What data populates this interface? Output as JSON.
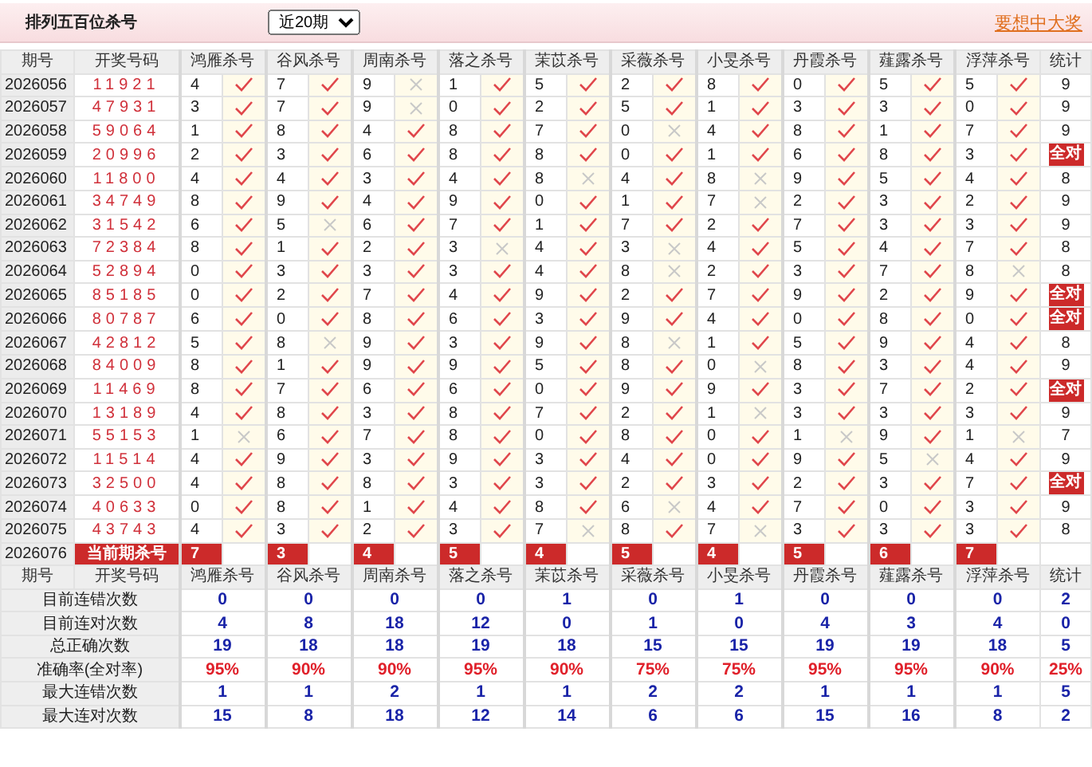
{
  "header": {
    "title": "排列五百位杀号",
    "period_select": "近20期",
    "promo_link": "要想中大奖"
  },
  "columns": [
    "期号",
    "开奖号码",
    "鸿雁杀号",
    "谷风杀号",
    "周南杀号",
    "落之杀号",
    "茉苡杀号",
    "采薇杀号",
    "小旻杀号",
    "丹霞杀号",
    "薤露杀号",
    "浮萍杀号",
    "统计"
  ],
  "rows": [
    {
      "period": "2026056",
      "numbers": "11921",
      "picks": [
        {
          "num": "4",
          "hit": true
        },
        {
          "num": "7",
          "hit": true
        },
        {
          "num": "9",
          "hit": false
        },
        {
          "num": "1",
          "hit": true
        },
        {
          "num": "5",
          "hit": true
        },
        {
          "num": "2",
          "hit": true
        },
        {
          "num": "8",
          "hit": true
        },
        {
          "num": "0",
          "hit": true
        },
        {
          "num": "5",
          "hit": true
        },
        {
          "num": "5",
          "hit": true
        }
      ],
      "total": {
        "text": "9",
        "kind": "count"
      }
    },
    {
      "period": "2026057",
      "numbers": "47931",
      "picks": [
        {
          "num": "3",
          "hit": true
        },
        {
          "num": "7",
          "hit": true
        },
        {
          "num": "9",
          "hit": false
        },
        {
          "num": "0",
          "hit": true
        },
        {
          "num": "2",
          "hit": true
        },
        {
          "num": "5",
          "hit": true
        },
        {
          "num": "1",
          "hit": true
        },
        {
          "num": "3",
          "hit": true
        },
        {
          "num": "3",
          "hit": true
        },
        {
          "num": "0",
          "hit": true
        }
      ],
      "total": {
        "text": "9",
        "kind": "count"
      }
    },
    {
      "period": "2026058",
      "numbers": "59064",
      "picks": [
        {
          "num": "1",
          "hit": true
        },
        {
          "num": "8",
          "hit": true
        },
        {
          "num": "4",
          "hit": true
        },
        {
          "num": "8",
          "hit": true
        },
        {
          "num": "7",
          "hit": true
        },
        {
          "num": "0",
          "hit": false
        },
        {
          "num": "4",
          "hit": true
        },
        {
          "num": "8",
          "hit": true
        },
        {
          "num": "1",
          "hit": true
        },
        {
          "num": "7",
          "hit": true
        }
      ],
      "total": {
        "text": "9",
        "kind": "count"
      }
    },
    {
      "period": "2026059",
      "numbers": "20996",
      "picks": [
        {
          "num": "2",
          "hit": true
        },
        {
          "num": "3",
          "hit": true
        },
        {
          "num": "6",
          "hit": true
        },
        {
          "num": "8",
          "hit": true
        },
        {
          "num": "8",
          "hit": true
        },
        {
          "num": "0",
          "hit": true
        },
        {
          "num": "1",
          "hit": true
        },
        {
          "num": "6",
          "hit": true
        },
        {
          "num": "8",
          "hit": true
        },
        {
          "num": "3",
          "hit": true
        }
      ],
      "total": {
        "text": "全对",
        "kind": "badge"
      }
    },
    {
      "period": "2026060",
      "numbers": "11800",
      "picks": [
        {
          "num": "4",
          "hit": true
        },
        {
          "num": "4",
          "hit": true
        },
        {
          "num": "3",
          "hit": true
        },
        {
          "num": "4",
          "hit": true
        },
        {
          "num": "8",
          "hit": false
        },
        {
          "num": "4",
          "hit": true
        },
        {
          "num": "8",
          "hit": false
        },
        {
          "num": "9",
          "hit": true
        },
        {
          "num": "5",
          "hit": true
        },
        {
          "num": "4",
          "hit": true
        }
      ],
      "total": {
        "text": "8",
        "kind": "count"
      }
    },
    {
      "period": "2026061",
      "numbers": "34749",
      "picks": [
        {
          "num": "8",
          "hit": true
        },
        {
          "num": "9",
          "hit": true
        },
        {
          "num": "4",
          "hit": true
        },
        {
          "num": "9",
          "hit": true
        },
        {
          "num": "0",
          "hit": true
        },
        {
          "num": "1",
          "hit": true
        },
        {
          "num": "7",
          "hit": false
        },
        {
          "num": "2",
          "hit": true
        },
        {
          "num": "3",
          "hit": true
        },
        {
          "num": "2",
          "hit": true
        }
      ],
      "total": {
        "text": "9",
        "kind": "count"
      }
    },
    {
      "period": "2026062",
      "numbers": "31542",
      "picks": [
        {
          "num": "6",
          "hit": true
        },
        {
          "num": "5",
          "hit": false
        },
        {
          "num": "6",
          "hit": true
        },
        {
          "num": "7",
          "hit": true
        },
        {
          "num": "1",
          "hit": true
        },
        {
          "num": "7",
          "hit": true
        },
        {
          "num": "2",
          "hit": true
        },
        {
          "num": "7",
          "hit": true
        },
        {
          "num": "3",
          "hit": true
        },
        {
          "num": "3",
          "hit": true
        }
      ],
      "total": {
        "text": "9",
        "kind": "count"
      }
    },
    {
      "period": "2026063",
      "numbers": "72384",
      "picks": [
        {
          "num": "8",
          "hit": true
        },
        {
          "num": "1",
          "hit": true
        },
        {
          "num": "2",
          "hit": true
        },
        {
          "num": "3",
          "hit": false
        },
        {
          "num": "4",
          "hit": true
        },
        {
          "num": "3",
          "hit": false
        },
        {
          "num": "4",
          "hit": true
        },
        {
          "num": "5",
          "hit": true
        },
        {
          "num": "4",
          "hit": true
        },
        {
          "num": "7",
          "hit": true
        }
      ],
      "total": {
        "text": "8",
        "kind": "count"
      }
    },
    {
      "period": "2026064",
      "numbers": "52894",
      "picks": [
        {
          "num": "0",
          "hit": true
        },
        {
          "num": "3",
          "hit": true
        },
        {
          "num": "3",
          "hit": true
        },
        {
          "num": "3",
          "hit": true
        },
        {
          "num": "4",
          "hit": true
        },
        {
          "num": "8",
          "hit": false
        },
        {
          "num": "2",
          "hit": true
        },
        {
          "num": "3",
          "hit": true
        },
        {
          "num": "7",
          "hit": true
        },
        {
          "num": "8",
          "hit": false
        }
      ],
      "total": {
        "text": "8",
        "kind": "count"
      }
    },
    {
      "period": "2026065",
      "numbers": "85185",
      "picks": [
        {
          "num": "0",
          "hit": true
        },
        {
          "num": "2",
          "hit": true
        },
        {
          "num": "7",
          "hit": true
        },
        {
          "num": "4",
          "hit": true
        },
        {
          "num": "9",
          "hit": true
        },
        {
          "num": "2",
          "hit": true
        },
        {
          "num": "7",
          "hit": true
        },
        {
          "num": "9",
          "hit": true
        },
        {
          "num": "2",
          "hit": true
        },
        {
          "num": "9",
          "hit": true
        }
      ],
      "total": {
        "text": "全对",
        "kind": "badge"
      }
    },
    {
      "period": "2026066",
      "numbers": "80787",
      "picks": [
        {
          "num": "6",
          "hit": true
        },
        {
          "num": "0",
          "hit": true
        },
        {
          "num": "8",
          "hit": true
        },
        {
          "num": "6",
          "hit": true
        },
        {
          "num": "3",
          "hit": true
        },
        {
          "num": "9",
          "hit": true
        },
        {
          "num": "4",
          "hit": true
        },
        {
          "num": "0",
          "hit": true
        },
        {
          "num": "8",
          "hit": true
        },
        {
          "num": "0",
          "hit": true
        }
      ],
      "total": {
        "text": "全对",
        "kind": "badge"
      }
    },
    {
      "period": "2026067",
      "numbers": "42812",
      "picks": [
        {
          "num": "5",
          "hit": true
        },
        {
          "num": "8",
          "hit": false
        },
        {
          "num": "9",
          "hit": true
        },
        {
          "num": "3",
          "hit": true
        },
        {
          "num": "9",
          "hit": true
        },
        {
          "num": "8",
          "hit": false
        },
        {
          "num": "1",
          "hit": true
        },
        {
          "num": "5",
          "hit": true
        },
        {
          "num": "9",
          "hit": true
        },
        {
          "num": "4",
          "hit": true
        }
      ],
      "total": {
        "text": "8",
        "kind": "count"
      }
    },
    {
      "period": "2026068",
      "numbers": "84009",
      "picks": [
        {
          "num": "8",
          "hit": true
        },
        {
          "num": "1",
          "hit": true
        },
        {
          "num": "9",
          "hit": true
        },
        {
          "num": "9",
          "hit": true
        },
        {
          "num": "5",
          "hit": true
        },
        {
          "num": "8",
          "hit": true
        },
        {
          "num": "0",
          "hit": false
        },
        {
          "num": "8",
          "hit": true
        },
        {
          "num": "3",
          "hit": true
        },
        {
          "num": "4",
          "hit": true
        }
      ],
      "total": {
        "text": "9",
        "kind": "count"
      }
    },
    {
      "period": "2026069",
      "numbers": "11469",
      "picks": [
        {
          "num": "8",
          "hit": true
        },
        {
          "num": "7",
          "hit": true
        },
        {
          "num": "6",
          "hit": true
        },
        {
          "num": "6",
          "hit": true
        },
        {
          "num": "0",
          "hit": true
        },
        {
          "num": "9",
          "hit": true
        },
        {
          "num": "9",
          "hit": true
        },
        {
          "num": "3",
          "hit": true
        },
        {
          "num": "7",
          "hit": true
        },
        {
          "num": "2",
          "hit": true
        }
      ],
      "total": {
        "text": "全对",
        "kind": "badge"
      }
    },
    {
      "period": "2026070",
      "numbers": "13189",
      "picks": [
        {
          "num": "4",
          "hit": true
        },
        {
          "num": "8",
          "hit": true
        },
        {
          "num": "3",
          "hit": true
        },
        {
          "num": "8",
          "hit": true
        },
        {
          "num": "7",
          "hit": true
        },
        {
          "num": "2",
          "hit": true
        },
        {
          "num": "1",
          "hit": false
        },
        {
          "num": "3",
          "hit": true
        },
        {
          "num": "3",
          "hit": true
        },
        {
          "num": "3",
          "hit": true
        }
      ],
      "total": {
        "text": "9",
        "kind": "count"
      }
    },
    {
      "period": "2026071",
      "numbers": "55153",
      "picks": [
        {
          "num": "1",
          "hit": false
        },
        {
          "num": "6",
          "hit": true
        },
        {
          "num": "7",
          "hit": true
        },
        {
          "num": "8",
          "hit": true
        },
        {
          "num": "0",
          "hit": true
        },
        {
          "num": "8",
          "hit": true
        },
        {
          "num": "0",
          "hit": true
        },
        {
          "num": "1",
          "hit": false
        },
        {
          "num": "9",
          "hit": true
        },
        {
          "num": "1",
          "hit": false
        }
      ],
      "total": {
        "text": "7",
        "kind": "count"
      }
    },
    {
      "period": "2026072",
      "numbers": "11514",
      "picks": [
        {
          "num": "4",
          "hit": true
        },
        {
          "num": "9",
          "hit": true
        },
        {
          "num": "3",
          "hit": true
        },
        {
          "num": "9",
          "hit": true
        },
        {
          "num": "3",
          "hit": true
        },
        {
          "num": "4",
          "hit": true
        },
        {
          "num": "0",
          "hit": true
        },
        {
          "num": "9",
          "hit": true
        },
        {
          "num": "5",
          "hit": false
        },
        {
          "num": "4",
          "hit": true
        }
      ],
      "total": {
        "text": "9",
        "kind": "count"
      }
    },
    {
      "period": "2026073",
      "numbers": "32500",
      "picks": [
        {
          "num": "4",
          "hit": true
        },
        {
          "num": "8",
          "hit": true
        },
        {
          "num": "8",
          "hit": true
        },
        {
          "num": "3",
          "hit": true
        },
        {
          "num": "3",
          "hit": true
        },
        {
          "num": "2",
          "hit": true
        },
        {
          "num": "3",
          "hit": true
        },
        {
          "num": "2",
          "hit": true
        },
        {
          "num": "3",
          "hit": true
        },
        {
          "num": "7",
          "hit": true
        }
      ],
      "total": {
        "text": "全对",
        "kind": "badge"
      }
    },
    {
      "period": "2026074",
      "numbers": "40633",
      "picks": [
        {
          "num": "0",
          "hit": true
        },
        {
          "num": "8",
          "hit": true
        },
        {
          "num": "1",
          "hit": true
        },
        {
          "num": "4",
          "hit": true
        },
        {
          "num": "8",
          "hit": true
        },
        {
          "num": "6",
          "hit": false
        },
        {
          "num": "4",
          "hit": true
        },
        {
          "num": "7",
          "hit": true
        },
        {
          "num": "0",
          "hit": true
        },
        {
          "num": "3",
          "hit": true
        }
      ],
      "total": {
        "text": "9",
        "kind": "count"
      }
    },
    {
      "period": "2026075",
      "numbers": "43743",
      "picks": [
        {
          "num": "4",
          "hit": true
        },
        {
          "num": "3",
          "hit": true
        },
        {
          "num": "2",
          "hit": true
        },
        {
          "num": "3",
          "hit": true
        },
        {
          "num": "7",
          "hit": false
        },
        {
          "num": "8",
          "hit": true
        },
        {
          "num": "7",
          "hit": false
        },
        {
          "num": "3",
          "hit": true
        },
        {
          "num": "3",
          "hit": true
        },
        {
          "num": "3",
          "hit": true
        }
      ],
      "total": {
        "text": "8",
        "kind": "count"
      }
    }
  ],
  "current": {
    "period": "2026076",
    "label": "当前期杀号",
    "picks": [
      "7",
      "3",
      "4",
      "5",
      "4",
      "5",
      "4",
      "5",
      "6",
      "7"
    ]
  },
  "stats_columns": [
    "期号",
    "开奖号码",
    "鸿雁杀号",
    "谷风杀号",
    "周南杀号",
    "落之杀号",
    "茉苡杀号",
    "采薇杀号",
    "小旻杀号",
    "丹霞杀号",
    "薤露杀号",
    "浮萍杀号",
    "统计"
  ],
  "stats": [
    {
      "label": "目前连错次数",
      "kind": "count",
      "values": [
        "0",
        "0",
        "0",
        "0",
        "1",
        "0",
        "1",
        "0",
        "0",
        "0"
      ],
      "total": "2"
    },
    {
      "label": "目前连对次数",
      "kind": "count",
      "values": [
        "4",
        "8",
        "18",
        "12",
        "0",
        "1",
        "0",
        "4",
        "3",
        "4"
      ],
      "total": "0"
    },
    {
      "label": "总正确次数",
      "kind": "count",
      "values": [
        "19",
        "18",
        "18",
        "19",
        "18",
        "15",
        "15",
        "19",
        "19",
        "18"
      ],
      "total": "5"
    },
    {
      "label": "准确率(全对率)",
      "kind": "rate",
      "values": [
        "95%",
        "90%",
        "90%",
        "95%",
        "90%",
        "75%",
        "75%",
        "95%",
        "95%",
        "90%"
      ],
      "total": "25%"
    },
    {
      "label": "最大连错次数",
      "kind": "count",
      "values": [
        "1",
        "1",
        "2",
        "1",
        "1",
        "2",
        "2",
        "1",
        "1",
        "1"
      ],
      "total": "5"
    },
    {
      "label": "最大连对次数",
      "kind": "count",
      "values": [
        "15",
        "8",
        "18",
        "12",
        "14",
        "6",
        "6",
        "15",
        "16",
        "8"
      ],
      "total": "2"
    }
  ]
}
